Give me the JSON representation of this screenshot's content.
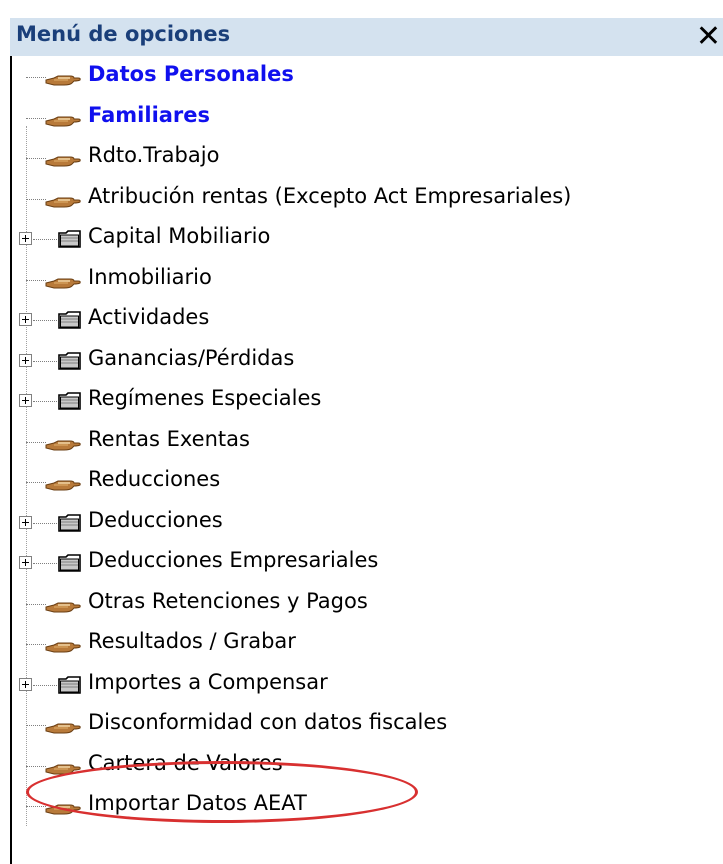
{
  "panel": {
    "title": "Menú de opciones",
    "close_glyph": "✕"
  },
  "items": [
    {
      "label": "Datos Personales",
      "icon": "hand-pointer-icon",
      "expandable": false,
      "bold": true
    },
    {
      "label": "Familiares",
      "icon": "hand-pointer-icon",
      "expandable": false,
      "bold": true
    },
    {
      "label": "Rdto.Trabajo",
      "icon": "hand-pointer-icon",
      "expandable": false
    },
    {
      "label": "Atribución rentas (Excepto Act Empresariales)",
      "icon": "hand-pointer-icon",
      "expandable": false
    },
    {
      "label": "Capital Mobiliario",
      "icon": "folder-icon",
      "expandable": true
    },
    {
      "label": "Inmobiliario",
      "icon": "hand-pointer-icon",
      "expandable": false
    },
    {
      "label": "Actividades",
      "icon": "folder-icon",
      "expandable": true
    },
    {
      "label": "Ganancias/Pérdidas",
      "icon": "folder-icon",
      "expandable": true
    },
    {
      "label": "Regímenes Especiales",
      "icon": "folder-icon",
      "expandable": true
    },
    {
      "label": "Rentas Exentas",
      "icon": "hand-pointer-icon",
      "expandable": false
    },
    {
      "label": "Reducciones",
      "icon": "hand-pointer-icon",
      "expandable": false
    },
    {
      "label": "Deducciones",
      "icon": "folder-icon",
      "expandable": true
    },
    {
      "label": "Deducciones Empresariales",
      "icon": "folder-icon",
      "expandable": true
    },
    {
      "label": "Otras Retenciones y Pagos",
      "icon": "hand-pointer-icon",
      "expandable": false
    },
    {
      "label": "Resultados / Grabar",
      "icon": "hand-pointer-icon",
      "expandable": false
    },
    {
      "label": "Importes a Compensar",
      "icon": "folder-icon",
      "expandable": true
    },
    {
      "label": "Disconformidad con datos fiscales",
      "icon": "hand-pointer-icon",
      "expandable": false
    },
    {
      "label": "Cartera de Valores",
      "icon": "hand-pointer-icon",
      "expandable": false
    },
    {
      "label": "Importar Datos AEAT",
      "icon": "hand-pointer-icon",
      "expandable": false,
      "highlighted": true
    }
  ],
  "colors": {
    "title_bg": "#d4e2ef",
    "title_text": "#1a3f7a",
    "bold_item": "#1010ee",
    "highlight_oval": "#d83030"
  }
}
